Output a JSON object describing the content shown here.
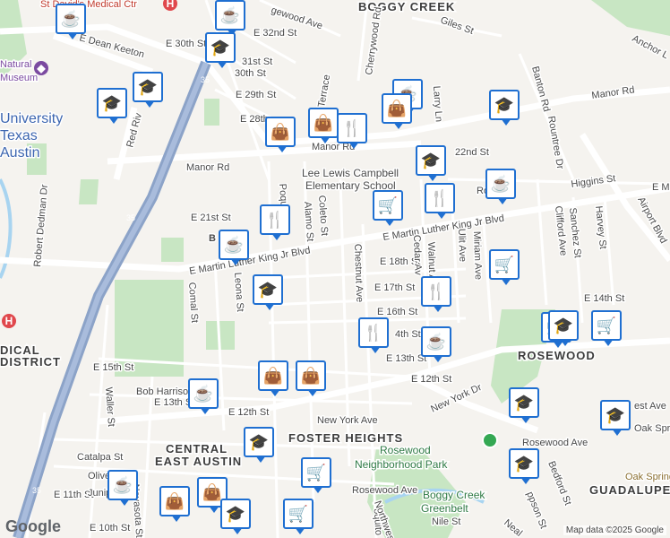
{
  "map": {
    "areas": [
      "BOGGY CREEK",
      "ROSEWOOD",
      "FOSTER HEIGHTS",
      "CENTRAL",
      "EAST AUSTIN",
      "GUADALUPE-SA",
      "DISTRICT"
    ],
    "landmarks": [
      "University",
      "Texas",
      "Austin",
      "St David's Medical Ctr",
      "Natural",
      "Museum",
      "Lee Lewis Campbell",
      "Elementary School",
      "Rosewood",
      "Neighborhood Park",
      "Boggy Creek",
      "Greenbelt",
      "DICAL"
    ],
    "streets": {
      "manor_rd_a": "Manor Rd",
      "manor_rd_b": "Manor Rd",
      "manor_rd_c": "Manor Rd",
      "mlk_west": "E Martin Luther King Jr Blvd",
      "mlk_east": "E Martin Luther King Jr Blvd",
      "mlk_far": "E Ma",
      "e_12th": "E 12th St",
      "e_12th_b": "E 12th St",
      "e_13th": "E 13th St",
      "e_13th_b": "E 13th St",
      "e_14th": "E 14th St",
      "e_14th_b": "4th St",
      "e_15th": "E 15th St",
      "e_16th": "E 16th St",
      "e_17th": "E 17th St",
      "e_18th": "E 18th St",
      "e_21st": "E 21st St",
      "e_22nd": "22nd St",
      "e_28th": "E 28th",
      "e_29th": "E 29th St",
      "e_30th": "E 30th St",
      "e_31st": "31st St",
      "e_32nd": "E 32nd St",
      "e_30th_b": "30th St",
      "dean_keeton": "E Dean Keeton",
      "new_york": "New York Ave",
      "new_york_dr": "New York Dr",
      "rosewood_ave": "Rosewood Ave",
      "rosewood_ave_b": "Rosewood Ave",
      "bob_harrison": "Bob Harrison",
      "catalpa": "Catalpa St",
      "e_11th": "E 11th St",
      "e_10th": "E 10th St",
      "chestnut": "Chestnut Ave",
      "walnut": "Walnut Av",
      "cedar": "Cedar Av",
      "ulit": "Ulit Ave",
      "miriam": "Miriam Ave",
      "coleto": "Coleto St",
      "alamo": "Alamo St",
      "comal": "Comal St",
      "leona": "Leona St",
      "waller": "Waller St",
      "navasota": "Navasota St",
      "red_river": "Red Riv",
      "robert_dedman": "Robert Dedman Dr",
      "cherrywood": "Cherrywood Rd",
      "giles": "Giles St",
      "banton": "Banton Rd",
      "rountree": "Rountree Dr",
      "clifford": "Clifford Ave",
      "sanchez": "Sanchez St",
      "harvey": "Harvey St",
      "higgins": "Higgins St",
      "airport": "Airport Blvd",
      "anchor": "Anchor L",
      "larry": "Larry Ln",
      "bedford": "Bedford St",
      "nile": "Nile St",
      "oak_springs": "Oak Spring",
      "oak_springs_b": "Oak Spring",
      "west_ave": "est Ave",
      "i35_a": "35",
      "i35_b": "35",
      "i35_c": "35",
      "terrace": "Terrace",
      "edgewood": "gewood Ave",
      "poquito": "Poquito",
      "poquito_b": "Poquito",
      "olive": "Olive",
      "juniper": "Junip",
      "northwestern": "Northwes",
      "neal": "Neal",
      "ro": "Ro",
      "poi_b": "B",
      "ppson": "ppson St"
    },
    "footer": {
      "logo": "Google",
      "attribution": "Map data ©2025 Google"
    },
    "colors": {
      "background": "#f5f3ef",
      "road": "#ffffff",
      "highway": "#8ca3c8",
      "park": "#c8e6c3",
      "water": "#a8d4f0",
      "marker_border": "#1f6fd1",
      "hospital": "#e0474c"
    },
    "pois": [
      {
        "icon": "coffee-cup",
        "kind": "cafe"
      },
      {
        "icon": "coffee-cup",
        "kind": "cafe"
      },
      {
        "icon": "graduation-cap",
        "kind": "school"
      },
      {
        "icon": "graduation-cap",
        "kind": "school"
      },
      {
        "icon": "graduation-cap",
        "kind": "school"
      },
      {
        "icon": "coffee-cup",
        "kind": "cafe"
      },
      {
        "icon": "shopping-bag",
        "kind": "store"
      },
      {
        "icon": "shopping-bag",
        "kind": "store"
      },
      {
        "icon": "fork-knife",
        "kind": "restaurant"
      },
      {
        "icon": "shopping-bag",
        "kind": "store"
      },
      {
        "icon": "graduation-cap",
        "kind": "school"
      },
      {
        "icon": "graduation-cap",
        "kind": "school"
      },
      {
        "icon": "coffee-cup",
        "kind": "cafe"
      },
      {
        "icon": "shopping-cart",
        "kind": "grocery"
      },
      {
        "icon": "fork-knife",
        "kind": "restaurant"
      },
      {
        "icon": "fork-knife",
        "kind": "restaurant"
      },
      {
        "icon": "coffee-cup",
        "kind": "cafe"
      },
      {
        "icon": "graduation-cap",
        "kind": "school"
      },
      {
        "icon": "shopping-cart",
        "kind": "grocery"
      },
      {
        "icon": "fork-knife",
        "kind": "restaurant"
      },
      {
        "icon": "fork-knife",
        "kind": "restaurant"
      },
      {
        "icon": "coffee-cup",
        "kind": "cafe"
      },
      {
        "icon": "shopping-cart",
        "kind": "grocery"
      },
      {
        "icon": "shopping-cart",
        "kind": "grocery"
      },
      {
        "icon": "shopping-bag",
        "kind": "store"
      },
      {
        "icon": "shopping-bag",
        "kind": "store"
      },
      {
        "icon": "coffee-cup",
        "kind": "cafe"
      },
      {
        "icon": "graduation-cap",
        "kind": "school"
      },
      {
        "icon": "graduation-cap",
        "kind": "school"
      },
      {
        "icon": "graduation-cap",
        "kind": "school"
      },
      {
        "icon": "shopping-cart",
        "kind": "grocery"
      },
      {
        "icon": "graduation-cap",
        "kind": "school"
      },
      {
        "icon": "coffee-cup",
        "kind": "cafe"
      },
      {
        "icon": "shopping-bag",
        "kind": "store"
      },
      {
        "icon": "shopping-bag",
        "kind": "store"
      },
      {
        "icon": "graduation-cap",
        "kind": "school"
      },
      {
        "icon": "shopping-cart",
        "kind": "grocery"
      },
      {
        "icon": "graduation-cap",
        "kind": "school"
      }
    ]
  }
}
